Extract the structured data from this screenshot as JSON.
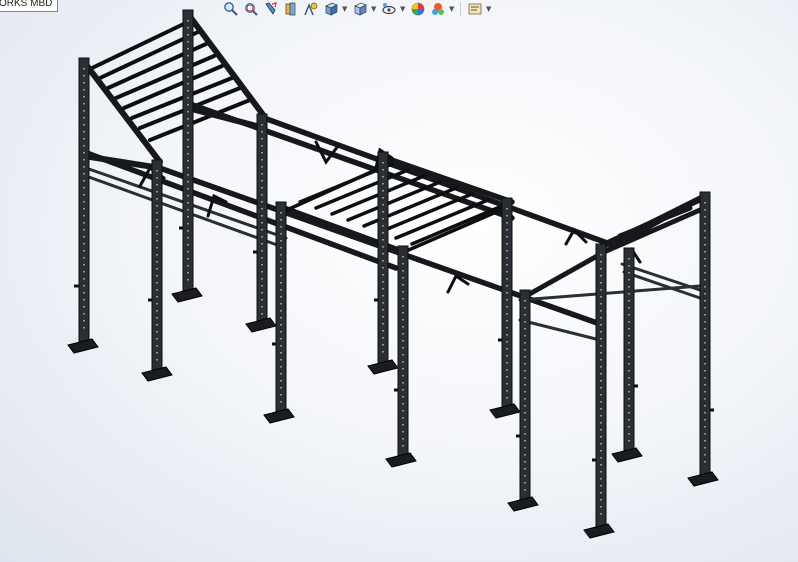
{
  "app": {
    "tab_label": "ORKS MBD"
  },
  "toolbar": {
    "buttons": [
      {
        "name": "zoom-to-fit-icon",
        "has_dropdown": false
      },
      {
        "name": "zoom-to-area-icon",
        "has_dropdown": false
      },
      {
        "name": "previous-view-icon",
        "has_dropdown": false
      },
      {
        "name": "section-view-icon",
        "has_dropdown": false
      },
      {
        "name": "dynamic-annotation-icon",
        "has_dropdown": false
      },
      {
        "name": "view-orientation-icon",
        "has_dropdown": true
      },
      {
        "name": "display-style-icon",
        "has_dropdown": true
      },
      {
        "name": "hide-show-items-icon",
        "has_dropdown": true
      },
      {
        "name": "edit-appearance-icon",
        "has_dropdown": false
      },
      {
        "name": "apply-scene-icon",
        "has_dropdown": true
      },
      {
        "name": "view-settings-icon",
        "has_dropdown": true
      }
    ]
  },
  "colors": {
    "frame_fill": "#2b2e33",
    "frame_edge": "#0d0e10",
    "background_center": "#ffffff",
    "background_edge": "#dfe5ee"
  }
}
